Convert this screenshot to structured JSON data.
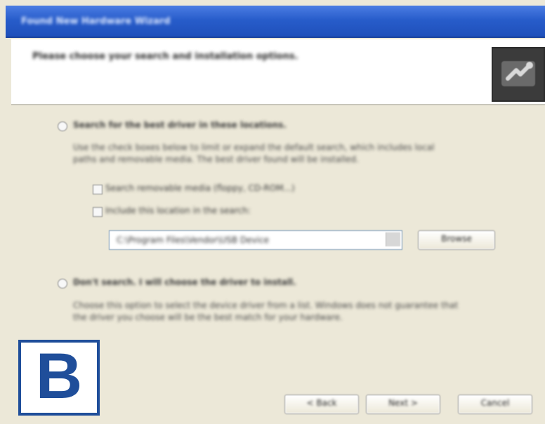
{
  "window": {
    "title": "Found New Hardware Wizard",
    "title_bar_color": "#275cca"
  },
  "header": {
    "heading": "Please choose your search and installation options."
  },
  "options": {
    "search_label": "Search for the best driver in these locations.",
    "search_description": [
      "Use the check boxes below to limit or expand the default search, which includes local",
      "paths and removable media. The best driver found will be installed."
    ],
    "search_removable_media_label": "Search removable media (floppy, CD-ROM...)",
    "include_location_label": "Include this location in the search:",
    "location_value": "C:\\Program Files\\Vendor\\USB Device",
    "browse_label": "Browse",
    "dont_search_label": "Don't search. I will choose the driver to install.",
    "dont_search_description": [
      "Choose this option to select the device driver from a list. Windows does not guarantee that",
      "the driver you choose will be the best match for your hardware."
    ]
  },
  "buttons": {
    "back_label": "< Back",
    "next_label": "Next >",
    "cancel_label": "Cancel"
  },
  "overlay": {
    "letter": "B",
    "border_color": "#1f4e9a"
  }
}
